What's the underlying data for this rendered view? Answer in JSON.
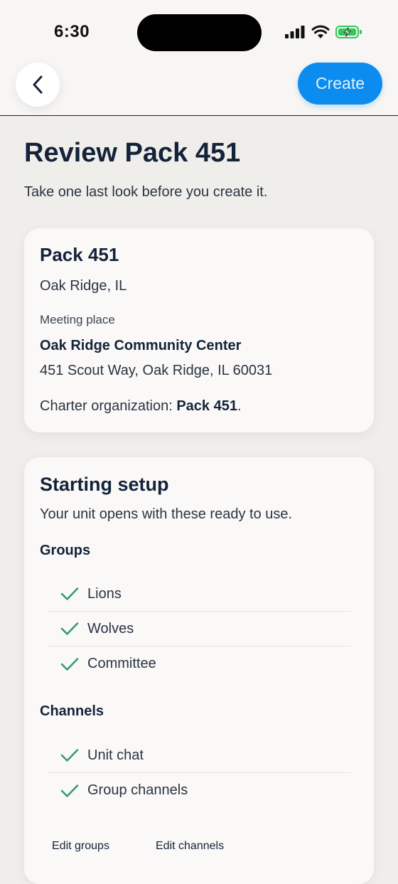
{
  "status": {
    "time": "6:30"
  },
  "nav": {
    "back_icon": "chevron-left-icon",
    "create_label": "Create"
  },
  "page": {
    "title": "Review Pack 451",
    "subtitle": "Take one last look before you create it."
  },
  "unit_card": {
    "name": "Pack 451",
    "location": "Oak Ridge, IL",
    "meeting_label": "Meeting place",
    "meeting_name": "Oak Ridge Community Center",
    "meeting_address": "451 Scout Way, Oak Ridge, IL 60031",
    "charter_prefix": "Charter organization: ",
    "charter_org": "Pack 451",
    "charter_suffix": "."
  },
  "setup_card": {
    "title": "Starting setup",
    "description": "Your unit opens with these ready to use.",
    "groups_label": "Groups",
    "groups": [
      "Lions",
      "Wolves",
      "Committee"
    ],
    "channels_label": "Channels",
    "channels": [
      "Unit chat",
      "Group channels"
    ],
    "edit_groups_label": "Edit groups",
    "edit_channels_label": "Edit channels"
  },
  "colors": {
    "accent": "#0d8cf0",
    "check": "#3a9a6a",
    "text": "#14233a",
    "background": "#f0eeea"
  }
}
